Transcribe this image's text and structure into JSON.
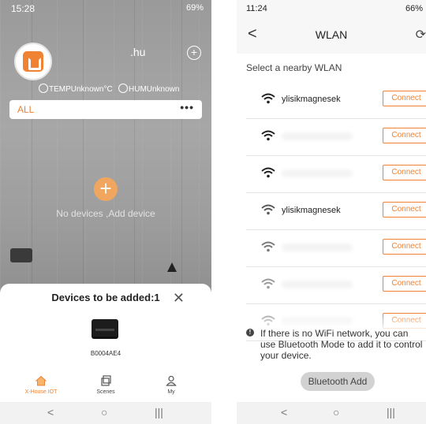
{
  "left": {
    "status_time": "15:28",
    "status_right": "69%",
    "user_suffix": ".hu",
    "temp_label": "TEMPUnknown°C",
    "hum_label": "HUMUnknown",
    "filter_label": "ALL",
    "empty_text": "No devices ,Add device",
    "sheet_title": "Devices to be added:1",
    "device_name": "B0004AE4",
    "tabs": [
      "X-House IOT",
      "Scenes",
      "My"
    ]
  },
  "right": {
    "status_time": "11:24",
    "status_right": "66%",
    "header_title": "WLAN",
    "select_label": "Select a nearby WLAN",
    "networks": [
      {
        "ssid": "ylisikmagnesek",
        "button": "Connect"
      },
      {
        "ssid": "",
        "button": "Connect"
      },
      {
        "ssid": "",
        "button": "Connect"
      },
      {
        "ssid": "ylisikmagnesek",
        "button": "Connect"
      },
      {
        "ssid": "",
        "button": "Connect"
      },
      {
        "ssid": "",
        "button": "Connect"
      },
      {
        "ssid": "",
        "button": "Connect"
      }
    ],
    "note": "If there is no WiFi network, you can use Bluetooth Mode to add it to control your device.",
    "bt_button": "Bluetooth Add"
  },
  "colors": {
    "accent": "#f08234",
    "wall": "#9a9a9a"
  }
}
